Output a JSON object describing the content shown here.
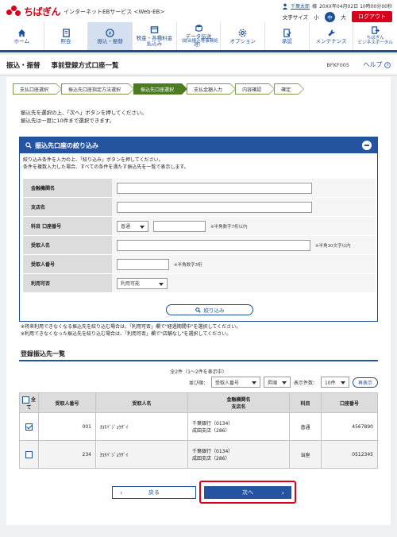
{
  "header": {
    "logo_text": "ちばぎん",
    "service_name": "インターネットEBサービス <Web-EB>",
    "user_name": "千葉太郎",
    "user_suffix": "様",
    "datetime": "20XX年04月02日 10時00分00秒",
    "font_size_label": "文字サイズ",
    "font_small": "小",
    "font_medium": "中",
    "font_large": "大",
    "logout_label": "ログアウト"
  },
  "nav": [
    {
      "l1": "ホーム",
      "l2": "",
      "icon": "home-icon",
      "active": false
    },
    {
      "l1": "照会",
      "l2": "",
      "icon": "inquiry-icon",
      "active": false
    },
    {
      "l1": "振込・振替",
      "l2": "",
      "icon": "transfer-icon",
      "active": true
    },
    {
      "l1": "税金・各種料金",
      "l2": "払込み",
      "icon": "tax-payment-icon",
      "active": false
    },
    {
      "l1": "データ伝送",
      "l2": "（総合振込等事務処理）",
      "icon": "data-transmission-icon",
      "active": false
    },
    {
      "l1": "オプション",
      "l2": "",
      "icon": "option-icon",
      "active": false
    },
    {
      "l1": "承認",
      "l2": "",
      "icon": "approval-icon",
      "active": false
    },
    {
      "l1": "メンテナンス",
      "l2": "",
      "icon": "maintenance-icon",
      "active": false
    },
    {
      "l1": "ちばぎん",
      "l2": "ビジネスポータル",
      "icon": "business-portal-icon",
      "active": false
    }
  ],
  "page": {
    "category": "振込・振替",
    "title": "事前登録方式口座一覧",
    "screen_id": "BFKF005",
    "help_label": "ヘルプ"
  },
  "steps": [
    {
      "label": "支払口座選択",
      "active": false
    },
    {
      "label": "振込先口座指定方法選択",
      "active": false
    },
    {
      "label": "振込先口座選択",
      "active": true
    },
    {
      "label": "支払金額入力",
      "active": false
    },
    {
      "label": "内容確認",
      "active": false
    },
    {
      "label": "確定",
      "active": false
    }
  ],
  "instructions": {
    "line1": "振込先を選択の上、「次へ」ボタンを押してください。",
    "line2": "振込先は一度に10件まで選択できます。"
  },
  "filter": {
    "title": "振込先口座の絞り込み",
    "desc1": "絞り込み条件を入力の上、「絞り込み」ボタンを押してください。",
    "desc2": "条件を複数入力した場合、すべての条件を満たす振込先を一覧で表示します。",
    "labels": {
      "bank": "金融機関名",
      "branch": "支店名",
      "account": "科目 口座番号",
      "payee": "受取人名",
      "payee_no": "受取人番号",
      "availability": "利用可否"
    },
    "account_type": "普通",
    "account_hint": "※半角数字7桁以内",
    "payee_hint": "※半角30文字以内",
    "payee_no_hint": "※半角数字3桁",
    "availability_value": "利用可能",
    "button_label": "絞り込み"
  },
  "notes": {
    "line1": "※将来利用できなくなる振込先を絞り込む場合は、「利用可否」欄で\"経過期間中\"を選択してください。",
    "line2": "※利用できなくなった振込先を絞り込む場合は、「利用可否」欄で\"店舗なし\"を選択してください。"
  },
  "list": {
    "title": "登録振込先一覧",
    "count_text": "全2件（1～2件を表示中）",
    "sort_label": "並び順：",
    "sort_value": "受取人番号",
    "order_value": "昇順",
    "display_label": "表示件数：",
    "display_value": "10件",
    "redisplay_label": "再表示",
    "headers": {
      "all": "全て",
      "payee_no": "受取人番号",
      "payee_name": "受取人名",
      "bank_branch_1": "金融機関名",
      "bank_branch_2": "支店名",
      "subject": "科目",
      "account": "口座番号"
    },
    "rows": [
      {
        "checked": true,
        "payee_no": "001",
        "payee_name": "ｶ)ﾁﾊﾞｼﾞｮｳｻﾞｲ",
        "bank": "千葉銀行（0134）",
        "branch": "成田支店（286）",
        "subject": "普通",
        "account": "4567890"
      },
      {
        "checked": false,
        "payee_no": "234",
        "payee_name": "ｶ)ﾁﾊﾞｼﾞｮｳｻﾞｲ",
        "bank": "千葉銀行（0134）",
        "branch": "成田支店（286）",
        "subject": "当座",
        "account": "0512345"
      }
    ]
  },
  "buttons": {
    "back_label": "戻る",
    "next_label": "次へ"
  }
}
